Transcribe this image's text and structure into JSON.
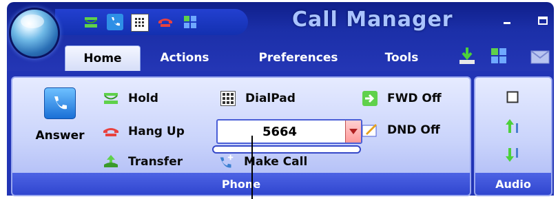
{
  "window": {
    "title": "Call Manager",
    "minimize_label": "–",
    "maximize_label": "▭"
  },
  "quick_access": {
    "icons": [
      "hold-icon",
      "phone-icon",
      "dialpad-icon",
      "hangup-icon",
      "grid-icon"
    ]
  },
  "tabs": [
    {
      "label": "Home",
      "active": true
    },
    {
      "label": "Actions",
      "active": false
    },
    {
      "label": "Preferences",
      "active": false
    },
    {
      "label": "Tools",
      "active": false
    }
  ],
  "ribbon_right_icons": [
    "download-icon",
    "grid-icon",
    "mail-icon"
  ],
  "phone_group": {
    "label": "Phone",
    "answer": {
      "label": "Answer",
      "icon": "phone-handset-icon"
    },
    "hold": {
      "label": "Hold",
      "icon": "hold-icon"
    },
    "hang_up": {
      "label": "Hang Up",
      "icon": "hangup-icon"
    },
    "transfer": {
      "label": "Transfer",
      "icon": "transfer-icon"
    },
    "dialpad": {
      "label": "DialPad",
      "icon": "dialpad-icon"
    },
    "number_value": "5664",
    "make_call": {
      "label": "Make Call",
      "icon": "make-call-icon"
    },
    "fwd": {
      "label": "FWD Off",
      "icon": "forward-icon"
    },
    "dnd": {
      "label": "DND Off",
      "icon": "dnd-icon"
    }
  },
  "audio_group": {
    "label": "Audio",
    "icons": [
      "square-icon",
      "volume-up-icon",
      "volume-down-icon"
    ]
  },
  "colors": {
    "ribbon_blue": "#2134b5",
    "title_text": "#aac4ff",
    "accent_green": "#3aa629",
    "accent_red": "#d63b3b"
  }
}
